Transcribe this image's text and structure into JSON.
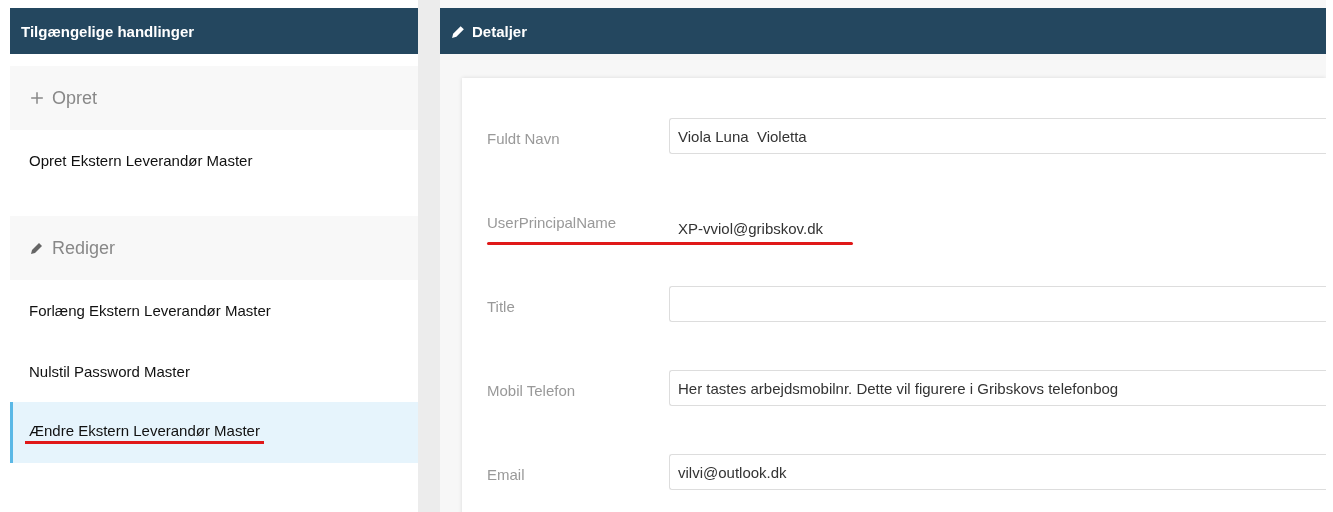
{
  "actions_panel": {
    "title": "Tilgængelige handlinger",
    "sections": [
      {
        "label": "Opret",
        "items": [
          {
            "label": "Opret Ekstern Leverandør Master",
            "selected": false,
            "underlined": false
          }
        ]
      },
      {
        "label": "Rediger",
        "items": [
          {
            "label": "Forlæng Ekstern Leverandør Master",
            "selected": false,
            "underlined": false
          },
          {
            "label": "Nulstil Password Master",
            "selected": false,
            "underlined": false
          },
          {
            "label": "Ændre Ekstern Leverandør Master",
            "selected": true,
            "underlined": true
          }
        ]
      }
    ]
  },
  "details_panel": {
    "title": "Detaljer",
    "fields": [
      {
        "label": "Fuldt Navn",
        "kind": "input",
        "value": "Viola Luna  Violetta",
        "underlined": false
      },
      {
        "label": "UserPrincipalName",
        "kind": "text",
        "value": "XP-vviol@gribskov.dk",
        "underlined": true
      },
      {
        "label": "Title",
        "kind": "input",
        "underlined": false
      },
      {
        "label": "Mobil Telefon",
        "kind": "input",
        "value": "Her tastes arbejdsmobilnr. Dette vil figurere i Gribskovs telefonbog",
        "underlined": false
      },
      {
        "label": "Email",
        "kind": "input",
        "value": "vilvi@outlook.dk",
        "underlined": false
      }
    ]
  }
}
